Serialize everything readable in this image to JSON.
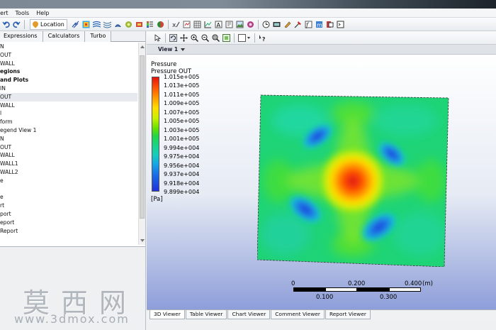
{
  "menubar": {
    "items": [
      "sert",
      "Tools",
      "Help"
    ]
  },
  "toolbar": {
    "location_label": "Location"
  },
  "left_panel": {
    "tabs": [
      "Expressions",
      "Calculators",
      "Turbo"
    ],
    "tree": [
      {
        "label": "N",
        "bold": false,
        "selected": false
      },
      {
        "label": "OUT",
        "bold": false,
        "selected": false
      },
      {
        "label": "WALL",
        "bold": false,
        "selected": false
      },
      {
        "label": "egions",
        "bold": true,
        "selected": false
      },
      {
        "label": "and Plots",
        "bold": true,
        "selected": false
      },
      {
        "label": "IN",
        "bold": false,
        "selected": false
      },
      {
        "label": "OUT",
        "bold": false,
        "selected": true
      },
      {
        "label": "WALL",
        "bold": false,
        "selected": false
      },
      {
        "label": "l",
        "bold": false,
        "selected": false
      },
      {
        "label": "form",
        "bold": false,
        "selected": false
      },
      {
        "label": "egend View 1",
        "bold": false,
        "selected": false
      },
      {
        "label": "N",
        "bold": false,
        "selected": false
      },
      {
        "label": "OUT",
        "bold": false,
        "selected": false
      },
      {
        "label": "WALL",
        "bold": false,
        "selected": false
      },
      {
        "label": "WALL1",
        "bold": false,
        "selected": false
      },
      {
        "label": "WALL2",
        "bold": false,
        "selected": false
      },
      {
        "label": "e",
        "bold": false,
        "selected": false
      },
      {
        "label": "",
        "bold": false,
        "selected": false
      },
      {
        "label": "e",
        "bold": false,
        "selected": false
      },
      {
        "label": "rt",
        "bold": false,
        "selected": false
      },
      {
        "label": "port",
        "bold": false,
        "selected": false
      },
      {
        "label": "eport",
        "bold": false,
        "selected": false
      },
      {
        "label": "Report",
        "bold": false,
        "selected": false
      }
    ]
  },
  "viewer": {
    "view_title": "View 1",
    "legend": {
      "title": "Pressure",
      "subtitle": "Pressure OUT",
      "unit": "[Pa]",
      "ticks": [
        "1.015e+005",
        "1.013e+005",
        "1.011e+005",
        "1.009e+005",
        "1.007e+005",
        "1.005e+005",
        "1.003e+005",
        "1.001e+005",
        "9.994e+004",
        "9.975e+004",
        "9.956e+004",
        "9.937e+004",
        "9.918e+004",
        "9.899e+004"
      ]
    },
    "scale_bar": {
      "top_labels": [
        "0",
        "0.200",
        "0.400",
        "(m)"
      ],
      "bottom_labels": [
        "0.100",
        "0.300"
      ]
    },
    "bottom_tabs": [
      "3D Viewer",
      "Table Viewer",
      "Chart Viewer",
      "Comment Viewer",
      "Report Viewer"
    ]
  },
  "watermark": {
    "text_cn": "莫西网",
    "url": "www.3dmox.com"
  }
}
